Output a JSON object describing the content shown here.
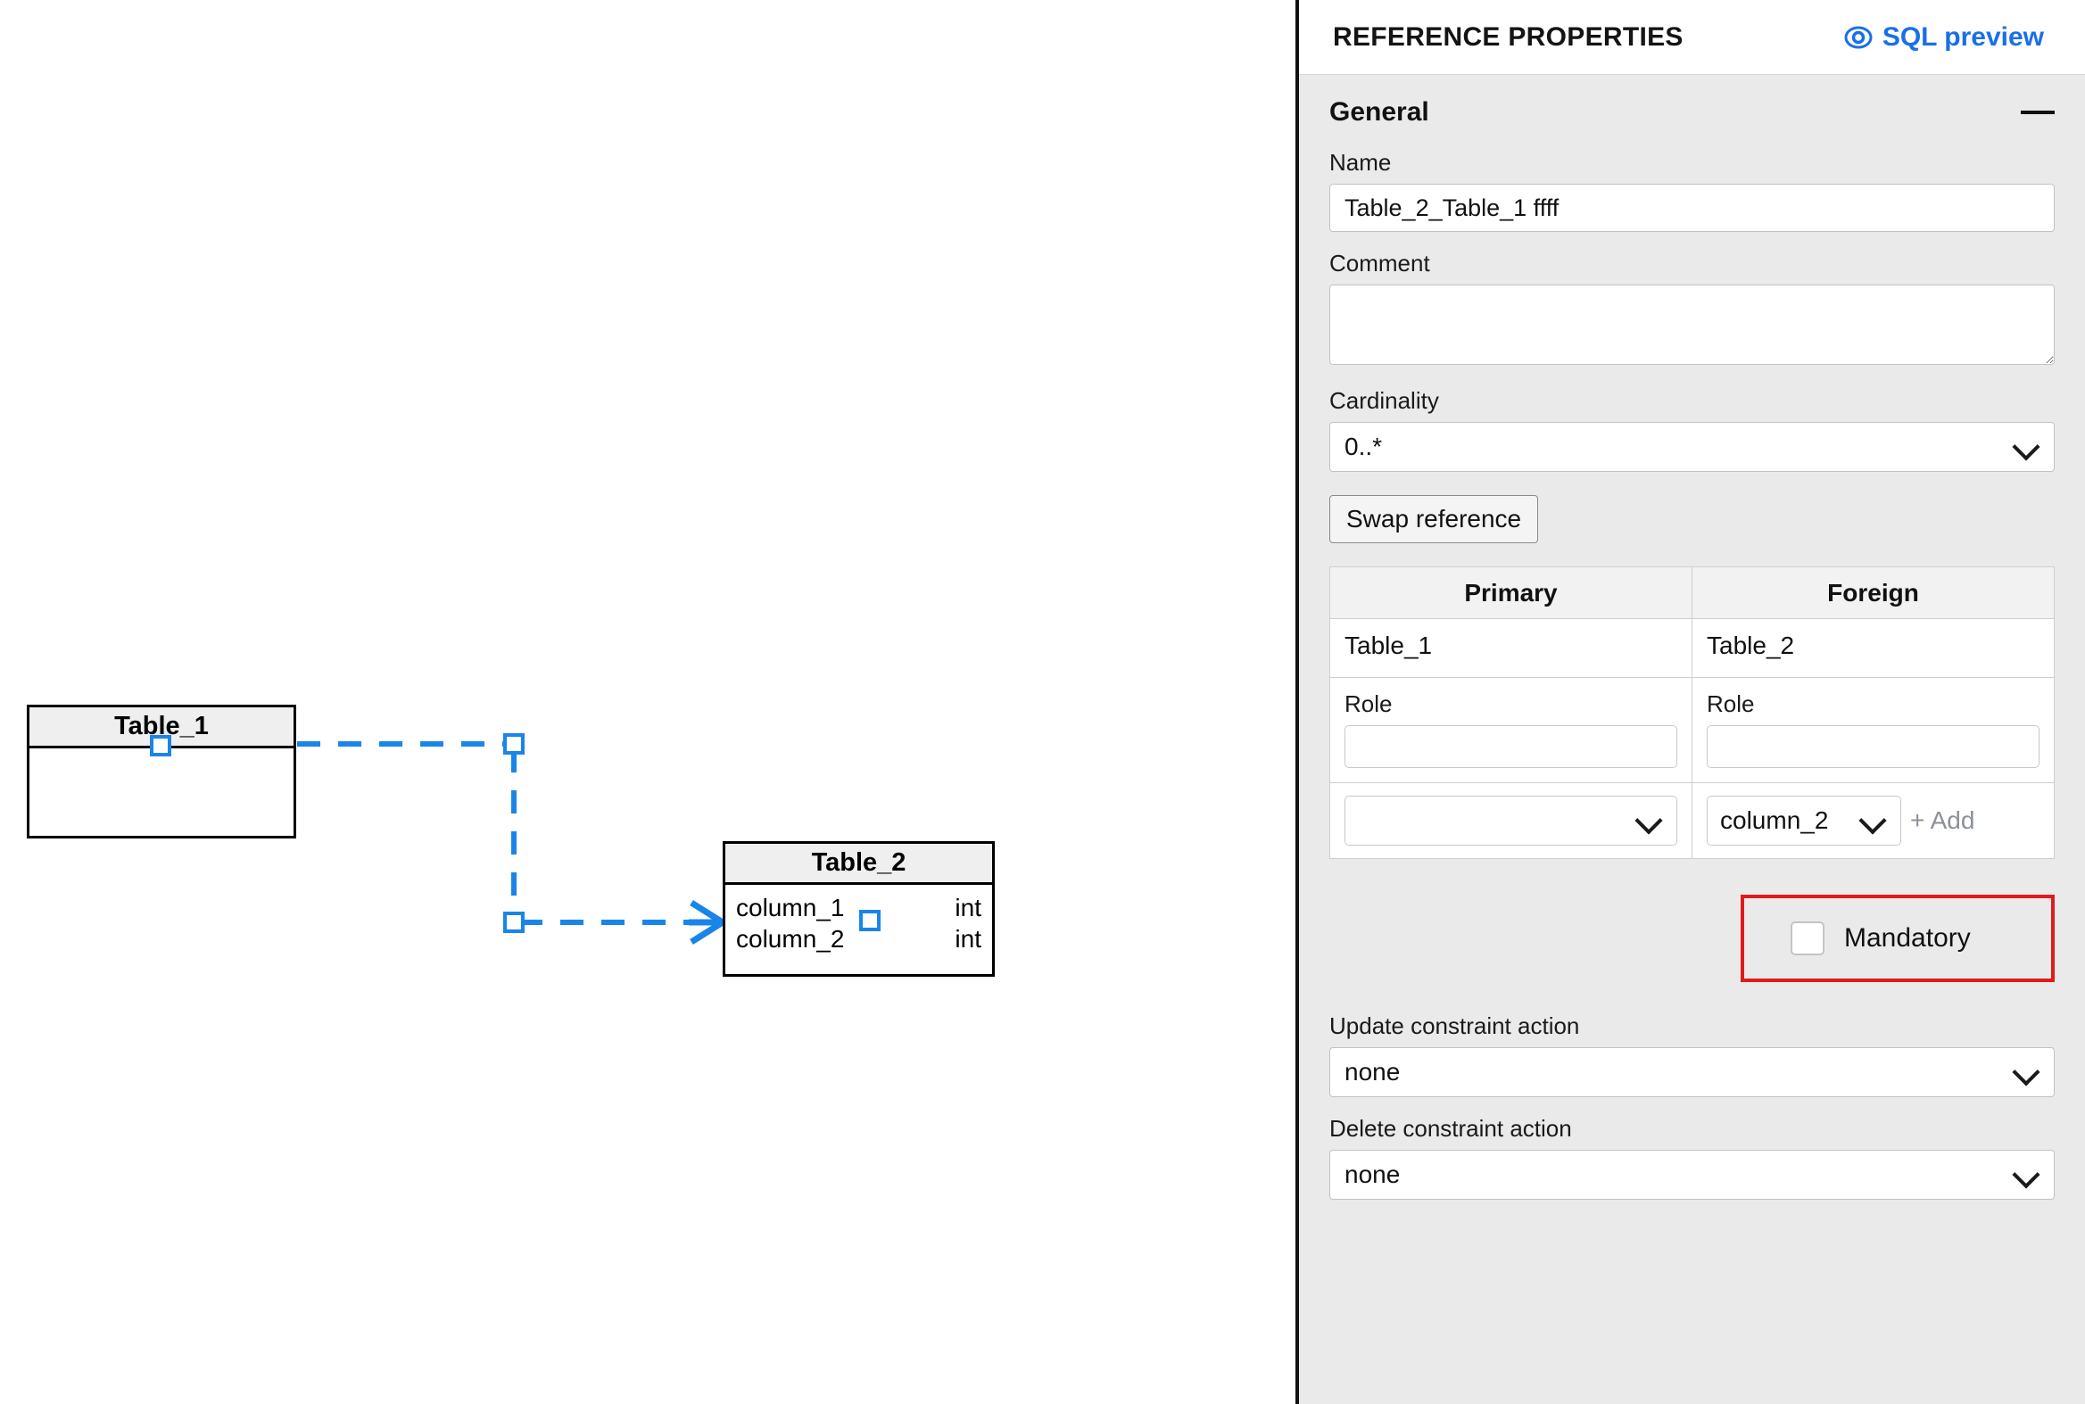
{
  "panel": {
    "title": "REFERENCE PROPERTIES",
    "sql_preview_label": "SQL preview",
    "sql_preview_icon": "eye-target-icon",
    "accent_blue": "#1a6fe8",
    "section": {
      "title": "General",
      "collapse_icon": "minus-icon"
    },
    "fields": {
      "name_label": "Name",
      "name_value": "Table_2_Table_1 ffff",
      "comment_label": "Comment",
      "comment_value": "",
      "cardinality_label": "Cardinality",
      "cardinality_value": "0..*",
      "swap_button_label": "Swap reference"
    },
    "mapping": {
      "headers": [
        "Primary",
        "Foreign"
      ],
      "primary": {
        "table": "Table_1",
        "role_label": "Role",
        "role_value": "",
        "column_value": ""
      },
      "foreign": {
        "table": "Table_2",
        "role_label": "Role",
        "role_value": "",
        "column_value": "column_2"
      },
      "add_label": "+ Add"
    },
    "mandatory": {
      "label": "Mandatory",
      "checked": false,
      "highlight_color": "#e01b1b"
    },
    "constraints": {
      "update_label": "Update constraint action",
      "update_value": "none",
      "delete_label": "Delete constraint action",
      "delete_value": "none"
    }
  },
  "canvas": {
    "entities": [
      {
        "name": "Table_1",
        "columns": []
      },
      {
        "name": "Table_2",
        "columns": [
          {
            "name": "column_1",
            "type": "int"
          },
          {
            "name": "column_2",
            "type": "int"
          }
        ]
      }
    ],
    "relationship": {
      "line_color": "#1a85e8",
      "style": "dashed",
      "terminator": "crows-foot"
    }
  }
}
